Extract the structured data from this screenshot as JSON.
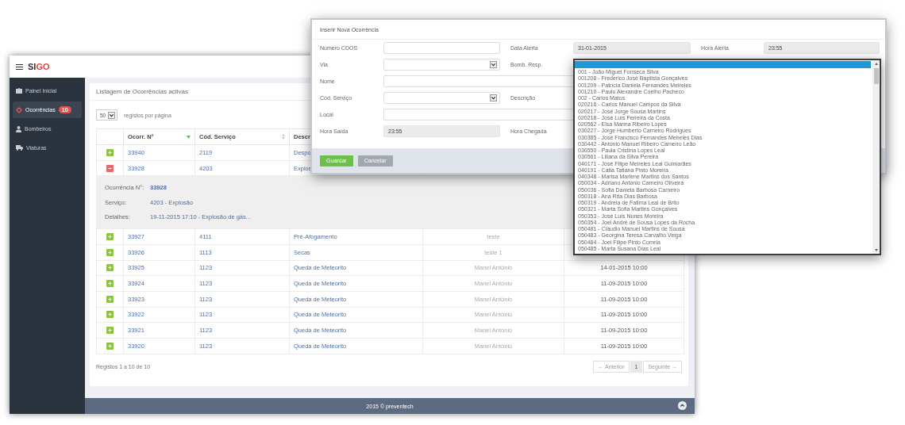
{
  "app": {
    "logo": [
      "SI",
      "GO"
    ],
    "sidebar": {
      "items": [
        {
          "label": "Painel Inicial",
          "selected": false
        },
        {
          "label": "Ocorrências",
          "badge": "10",
          "selected": true
        },
        {
          "label": "Bombeiros",
          "selected": false
        },
        {
          "label": "Viaturas",
          "selected": false
        }
      ]
    },
    "panel": {
      "title": "Listagem de Ocorrências activas",
      "page_length": "50",
      "page_length_label": "registos por página",
      "table": {
        "columns": [
          {
            "label": "Ocorr. N°",
            "sorted": true
          },
          {
            "label": "Cód. Serviço",
            "sorted": false
          },
          {
            "label": "Descr"
          }
        ],
        "rows": [
          {
            "expanded": false,
            "number": "33940",
            "code": "2119",
            "description": "Despo"
          },
          {
            "expanded": true,
            "number": "33928",
            "code": "4203",
            "description": "Explos",
            "details": [
              {
                "label": "Ocorrência N°:",
                "value": "33928",
                "bold": true
              },
              {
                "label": "Serviço:",
                "value": "4203 - Explosão",
                "bold": false
              },
              {
                "label": "Detalhes:",
                "value": "19-11-2015 17:10 - Explosão de gás...",
                "bold": false
              }
            ]
          },
          {
            "expanded": false,
            "number": "33927",
            "code": "4111",
            "description": "Pré-Afogamento",
            "column_5": "teste"
          },
          {
            "expanded": false,
            "number": "33926",
            "code": "1113",
            "description": "Secas",
            "column_5": "teste 1"
          },
          {
            "expanded": false,
            "number": "33925",
            "code": "1123",
            "description": "Queda de Meteorito",
            "column_5": "Manel António",
            "column_6": "14-01-2015 10:00"
          },
          {
            "expanded": false,
            "number": "33924",
            "code": "1123",
            "description": "Queda de Meteorito",
            "column_5": "Manel António",
            "column_6": "11-09-2015 10:00"
          },
          {
            "expanded": false,
            "number": "33923",
            "code": "1123",
            "description": "Queda de Meteorito",
            "column_5": "Manel António",
            "column_6": "11-09-2015 10:00"
          },
          {
            "expanded": false,
            "number": "33922",
            "code": "1123",
            "description": "Queda de Meteorito",
            "column_5": "Manel António",
            "column_6": "11-09-2015 10:00"
          },
          {
            "expanded": false,
            "number": "33921",
            "code": "1123",
            "description": "Queda de Meteorito",
            "column_5": "Manel António",
            "column_6": "11-09-2015 10:00"
          },
          {
            "expanded": false,
            "number": "33920",
            "code": "1123",
            "description": "Queda de Meteorito",
            "column_5": "Manel António",
            "column_6": "11-09-2015 10:00"
          }
        ]
      },
      "info": "Registos 1 a 10 de 10",
      "pagination": [
        {
          "label": "← Anterior",
          "selected": false,
          "disabled": true
        },
        {
          "label": "1",
          "selected": true,
          "disabled": false
        },
        {
          "label": "Seguinte →",
          "selected": false,
          "disabled": true
        }
      ]
    },
    "footer": "2015 © preventech"
  },
  "modal": {
    "title": "Inserir Nova Ocorrência",
    "rows": [
      [
        {
          "label": "Número CDOS",
          "kind": "text"
        },
        {
          "label": "Data Alerta",
          "kind": "readonly",
          "value": "31-01-2015"
        },
        {
          "label": "Hora Alerta",
          "kind": "readonly",
          "value": "23:55"
        }
      ],
      [
        {
          "label": "Via",
          "kind": "select"
        },
        {
          "label": "Bomb. Resp.",
          "kind": "listbox"
        }
      ],
      [
        {
          "label": "Nome",
          "kind": "text",
          "wide": true
        }
      ],
      [
        {
          "label": "Cód. Serviço",
          "kind": "select"
        },
        {
          "label": "Descrição",
          "kind": "hidden"
        }
      ],
      [
        {
          "label": "Local",
          "kind": "text",
          "wide": true
        }
      ],
      [
        {
          "label": "Hora Saída",
          "kind": "readonly",
          "value": "23:55"
        },
        {
          "label": "Hora Chegada",
          "kind": "hidden"
        }
      ]
    ],
    "listbox": {
      "blank_selected": true,
      "options": [
        "001 - João Miguel Fonseca Silva",
        "001208 - Frederico José Baptista Gonçalves",
        "001209 - Patrícia Daniela Fernandes Meireles",
        "001210 - Paulo Alexandre Coelho Pacheco",
        "002 - Carlos Matos",
        "020216 - Carlos Manuel Campos da Silva",
        "020217 - José Jorge Sousa Martins",
        "020218 - José Luís Ferreira da Costa",
        "020562 - Elsa Marina Ribeiro Lopes",
        "030227 - Jorge Humberto Carneiro Rodrigues",
        "030385 - José Francisco Fernandes Meireles Dias",
        "030442 - António Manuel Ribeiro Carneiro Leão",
        "030550 - Paula Cristina Lopes Leal",
        "030561 - Liliana da Silva Pereira",
        "040171 - José Filipe Meireles Leal Guimarães",
        "040191 - Cátia Tatiana Pinto Moreira",
        "040348 - Marisa Marlene Martins dos Santos",
        "050034 - Adriano António Carneiro Oliveira",
        "050036 - Sofia Daniela Barbosa Carneiro",
        "050318 - Ana Rita Dias Barbosa",
        "050319 - Andreia de Fatima Leal de Brito",
        "050321 - Marta Sofia Martins Gonçalves",
        "050353 - José Luís Nunes Moreira",
        "050354 - Joel André de Sousa Lopes da Rocha",
        "050481 - Cláudio Manuel Martins de Sousa",
        "050483 - Georgina Teresa Carvalho Veiga",
        "050484 - Joel Filipe Pinto Correia",
        "050485 - Marta Susana Dias Leal"
      ]
    },
    "buttons": [
      {
        "label": "Guardar",
        "kind": "primary"
      },
      {
        "label": "Cancelar",
        "kind": "secondary"
      }
    ]
  }
}
